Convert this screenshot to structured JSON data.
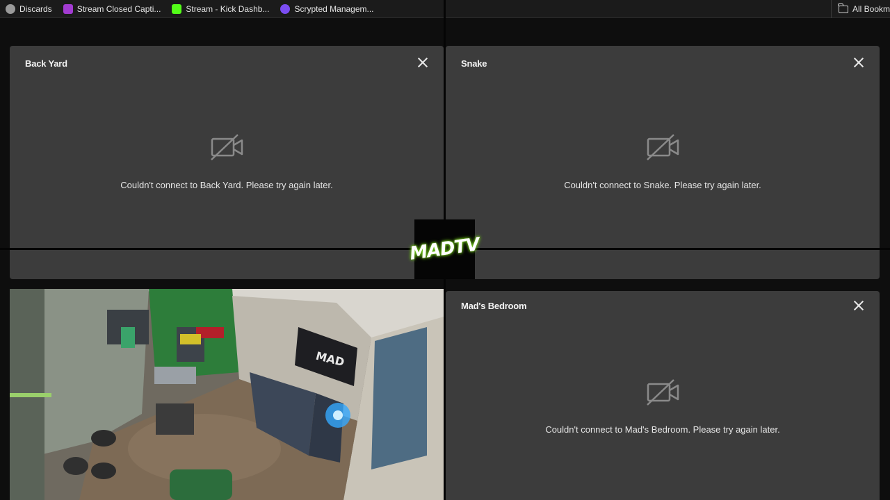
{
  "bookmarks": {
    "items": [
      {
        "label": "Discards",
        "icon": "globe-icon",
        "color": "#9a9a9a"
      },
      {
        "label": "Stream Closed Capti...",
        "icon": "captions-icon",
        "color": "#a23bd1"
      },
      {
        "label": "Stream - Kick Dashb...",
        "icon": "kick-icon",
        "color": "#53fc18"
      },
      {
        "label": "Scrypted Managem...",
        "icon": "scrypted-icon",
        "color": "#7b4df2"
      }
    ],
    "all_bookmarks": "All Bookm"
  },
  "panels": {
    "back_yard": {
      "title": "Back Yard",
      "error": "Couldn't connect to Back Yard. Please try again later."
    },
    "snake": {
      "title": "Snake",
      "error": "Couldn't connect to Snake. Please try again later."
    },
    "mads_bedroom": {
      "title": "Mad's Bedroom",
      "error": "Couldn't connect to Mad's Bedroom. Please try again later."
    }
  },
  "logo": {
    "text": "MADTV",
    "accent": "#76d21a"
  },
  "colors": {
    "panel_bg": "#3c3c3c",
    "page_bg": "#0e0e0e"
  }
}
